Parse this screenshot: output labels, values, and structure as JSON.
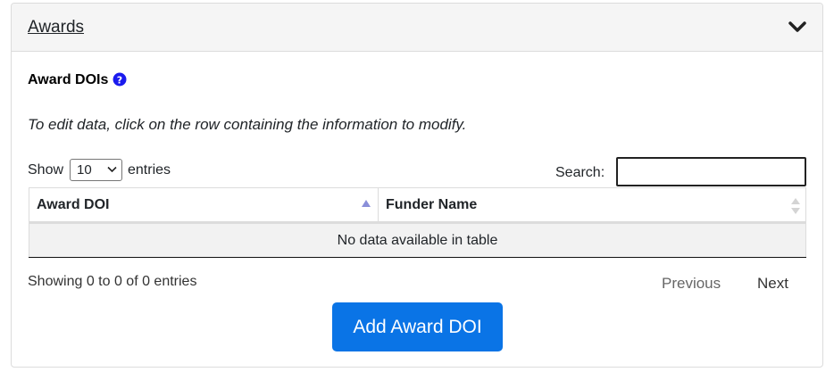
{
  "card": {
    "title": "Awards",
    "toggle_icon": "chevron-down-icon"
  },
  "section": {
    "label": "Award DOIs",
    "help_icon": "question-circle-icon",
    "help_color": "#1a1aee",
    "hint": "To edit data, click on the row containing the information to modify."
  },
  "length_menu": {
    "prefix": "Show",
    "selected": "10",
    "suffix": "entries"
  },
  "search": {
    "label": "Search:",
    "value": ""
  },
  "table": {
    "columns": [
      {
        "label": "Award DOI",
        "sort": "ascending",
        "sort_icon": "sort-asc-icon"
      },
      {
        "label": "Funder Name",
        "sort": "none",
        "sort_icon": "sort-both-icon"
      }
    ],
    "empty_message": "No data available in table"
  },
  "info": "Showing 0 to 0 of 0 entries",
  "pagination": {
    "previous": "Previous",
    "next": "Next"
  },
  "add_button": {
    "label": "Add Award DOI",
    "color": "#0a74e6"
  }
}
